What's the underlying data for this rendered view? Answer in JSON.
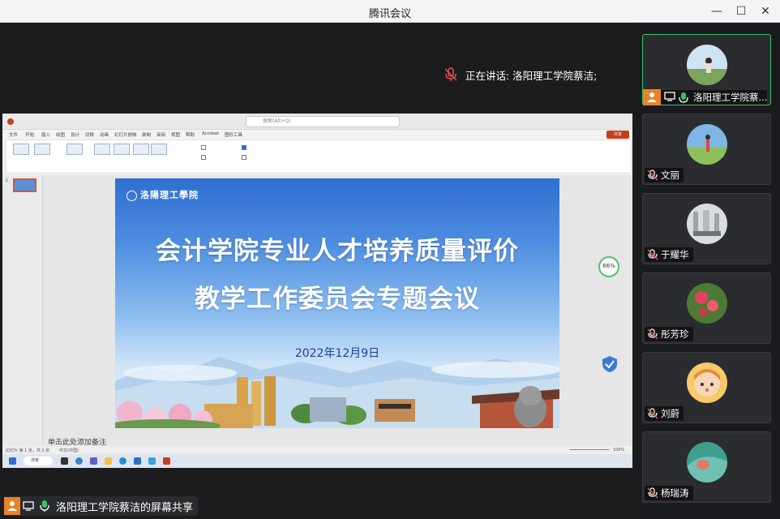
{
  "window": {
    "title": "腾讯会议",
    "minimize_glyph": "—",
    "maximize_glyph": "☐",
    "close_glyph": "✕"
  },
  "speaking": {
    "label": "正在讲话: 洛阳理工学院蔡洁;"
  },
  "presenter_bar": {
    "label": "洛阳理工学院蔡洁的屏幕共享"
  },
  "shared_screen": {
    "app": "PowerPoint",
    "search_placeholder": "搜索(Alt+Q)",
    "share_button": "共享",
    "tabs": [
      "文件",
      "开始",
      "插入",
      "绘图",
      "设计",
      "切换",
      "动画",
      "幻灯片放映",
      "录制",
      "审阅",
      "视图",
      "帮助",
      "Acrobat",
      "图形工具"
    ],
    "slide_number": "1",
    "slide": {
      "logo_text": "洛陽理工學院",
      "title_line1": "会计学院专业人才培养质量评价",
      "title_line2": "教学工作委员会专题会议",
      "date": "2022年12月9日"
    },
    "notes_placeholder": "单击此处添加备注",
    "status_left": "幻灯片 第 1 张，共 1 张",
    "status_lang": "中文(中国)",
    "zoom": "106%",
    "taskbar_search": "搜索",
    "speed_value": "66%"
  },
  "participants": [
    {
      "name": "洛阳理工学院蔡...",
      "active": true,
      "avatar": "grassland-photo"
    },
    {
      "name": "文丽",
      "active": false,
      "avatar": "field-photo"
    },
    {
      "name": "于耀华",
      "active": false,
      "avatar": "monument-photo"
    },
    {
      "name": "彤芳珍",
      "active": false,
      "avatar": "flowers-photo"
    },
    {
      "name": "刘蔚",
      "active": false,
      "avatar": "cartoon-girl"
    },
    {
      "name": "杨瑞涛",
      "active": false,
      "avatar": "green-abstract"
    }
  ],
  "colors": {
    "accent_green": "#35c46a",
    "muted_red": "#e05252",
    "host_orange": "#e8832a"
  }
}
